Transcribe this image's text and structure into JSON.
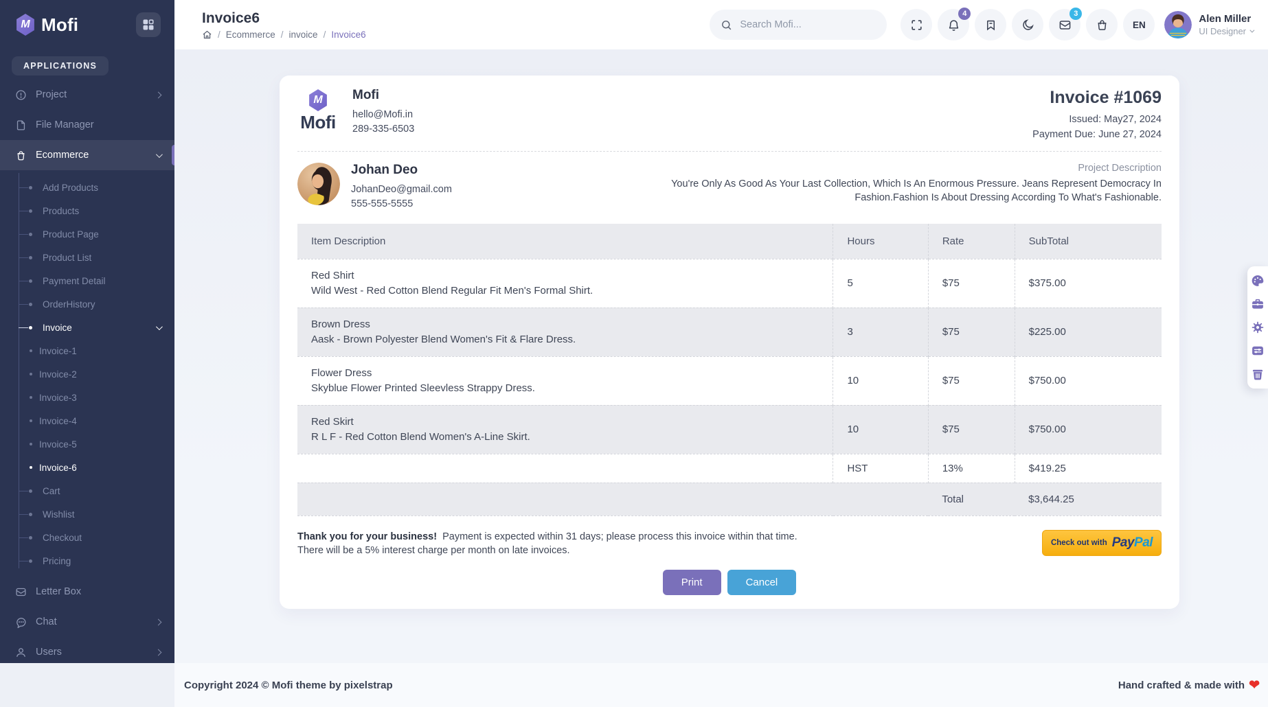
{
  "colors": {
    "primary": "#7a70ba",
    "secondary": "#48a3d7",
    "sidebar_bg": "#2b3452",
    "paypal_gold": "#f6ae0e"
  },
  "logo": {
    "letter": "M",
    "text": "Mofi"
  },
  "sidebar": {
    "section_label": "APPLICATIONS",
    "project": "Project",
    "file_manager": "File Manager",
    "ecommerce": "Ecommerce",
    "ecommerce_sub": [
      "Add Products",
      "Products",
      "Product Page",
      "Product List",
      "Payment Detail",
      "OrderHistory"
    ],
    "invoice": "Invoice",
    "invoice_sub": [
      "Invoice-1",
      "Invoice-2",
      "Invoice-3",
      "Invoice-4",
      "Invoice-5",
      "Invoice-6"
    ],
    "ecommerce_sub_tail": [
      "Cart",
      "Wishlist",
      "Checkout",
      "Pricing"
    ],
    "letter_box": "Letter Box",
    "chat": "Chat",
    "users": "Users"
  },
  "header": {
    "title": "Invoice6",
    "breadcrumb": [
      "Ecommerce",
      "invoice",
      "Invoice6"
    ],
    "search_placeholder": "Search Mofi...",
    "bell_badge": "4",
    "mail_badge": "3",
    "language": "EN",
    "user": {
      "name": "Alen Miller",
      "role": "UI Designer"
    }
  },
  "invoice": {
    "company": {
      "name": "Mofi",
      "email": "hello@Mofi.in",
      "phone": "289-335-6503"
    },
    "meta": {
      "number": "Invoice #1069",
      "issued": "Issued: May27, 2024",
      "due": "Payment Due: June 27, 2024"
    },
    "customer": {
      "name": "Johan Deo",
      "email": "JohanDeo@gmail.com",
      "phone": "555-555-5555"
    },
    "project": {
      "label": "Project Description",
      "description": "You're Only As Good As Your Last Collection, Which Is An Enormous Pressure. Jeans Represent Democracy In Fashion.Fashion Is About Dressing According To What's Fashionable."
    },
    "table": {
      "headers": [
        "Item Description",
        "Hours",
        "Rate",
        "SubTotal"
      ],
      "rows": [
        {
          "title": "Red Shirt",
          "desc": "Wild West - Red Cotton Blend Regular Fit Men's Formal Shirt.",
          "hours": "5",
          "rate": "$75",
          "subtotal": "$375.00"
        },
        {
          "title": "Brown Dress",
          "desc": "Aask - Brown Polyester Blend Women's Fit & Flare Dress.",
          "hours": "3",
          "rate": "$75",
          "subtotal": "$225.00"
        },
        {
          "title": "Flower Dress",
          "desc": "Skyblue Flower Printed Sleevless Strappy Dress.",
          "hours": "10",
          "rate": "$75",
          "subtotal": "$750.00"
        },
        {
          "title": "Red Skirt",
          "desc": "R L F - Red Cotton Blend Women's A-Line Skirt.",
          "hours": "10",
          "rate": "$75",
          "subtotal": "$750.00"
        }
      ],
      "tax": {
        "label": "HST",
        "rate": "13%",
        "amount": "$419.25"
      },
      "total": {
        "label": "Total",
        "amount": "$3,644.25"
      }
    },
    "notes": {
      "bold": "Thank you for your business!",
      "line1": "Payment is expected within 31 days; please process this invoice within that time.",
      "line2": "There will be a 5% interest charge per month on late invoices."
    },
    "paypal": {
      "prefix": "Check out with",
      "brand_a": "Pay",
      "brand_b": "Pal"
    },
    "actions": {
      "print": "Print",
      "cancel": "Cancel"
    }
  },
  "footer": {
    "copyright": "Copyright 2024 © Mofi theme by pixelstrap",
    "made": "Hand crafted & made with",
    "heart": "❤"
  }
}
